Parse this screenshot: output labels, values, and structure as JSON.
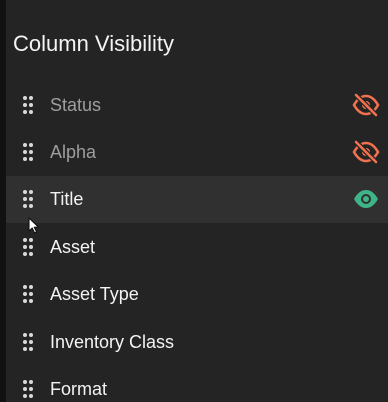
{
  "dialog": {
    "title": "Column Visibility"
  },
  "columns": [
    {
      "label": "Status",
      "visibility": "hidden",
      "icon": "eye-off-icon"
    },
    {
      "label": "Alpha",
      "visibility": "hidden",
      "icon": "eye-off-icon"
    },
    {
      "label": "Title",
      "visibility": "visible",
      "icon": "eye-icon"
    },
    {
      "label": "Asset"
    },
    {
      "label": "Asset Type"
    },
    {
      "label": "Inventory Class"
    },
    {
      "label": "Format"
    }
  ],
  "colors": {
    "panel_background": "#242424",
    "hover_row_background": "#303030",
    "hidden_icon": "#f0714f",
    "visible_icon": "#3fb489",
    "handle": "#d9d9d9",
    "dim_text": "#9e9e9e"
  }
}
